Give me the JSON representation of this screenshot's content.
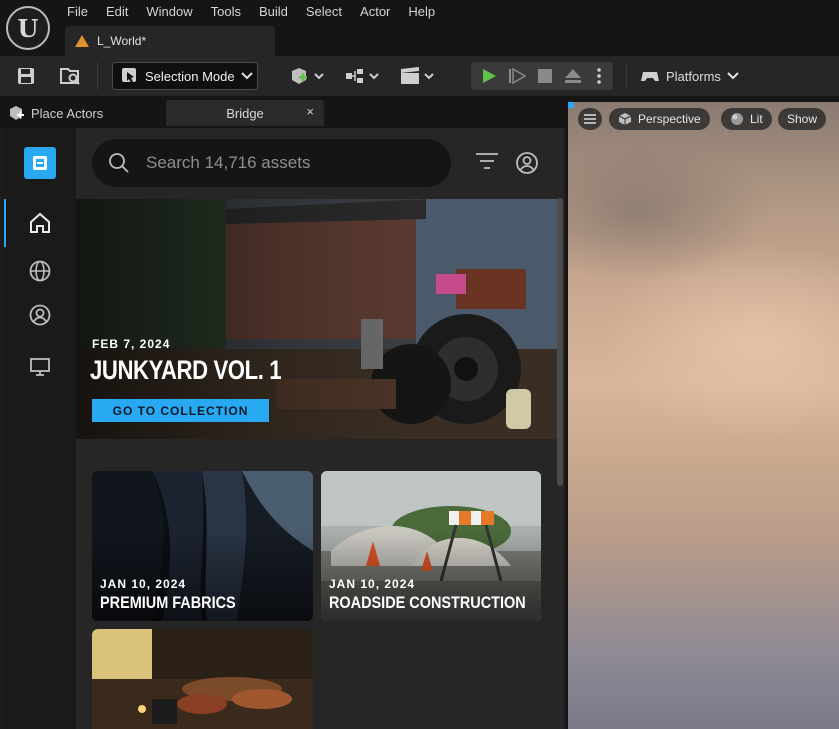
{
  "menu": {
    "items": [
      "File",
      "Edit",
      "Window",
      "Tools",
      "Build",
      "Select",
      "Actor",
      "Help"
    ]
  },
  "document_tab": {
    "label": "L_World*"
  },
  "toolbar": {
    "selection_mode": "Selection Mode",
    "platforms": "Platforms"
  },
  "panel_tabs": {
    "place_actors": "Place Actors",
    "bridge": "Bridge",
    "close_glyph": "×"
  },
  "bridge": {
    "search_placeholder": "Search 14,716 assets",
    "hero": {
      "date": "FEB 7, 2024",
      "title": "JUNKYARD VOL. 1",
      "button": "GO TO COLLECTION"
    },
    "cards": [
      {
        "date": "JAN 10, 2024",
        "title": "PREMIUM FABRICS"
      },
      {
        "date": "JAN 10, 2024",
        "title": "ROADSIDE CONSTRUCTION"
      },
      {
        "date": "",
        "title": ""
      }
    ],
    "accent_color": "#28a9f1"
  },
  "viewport": {
    "perspective": "Perspective",
    "lit": "Lit",
    "show": "Show"
  }
}
